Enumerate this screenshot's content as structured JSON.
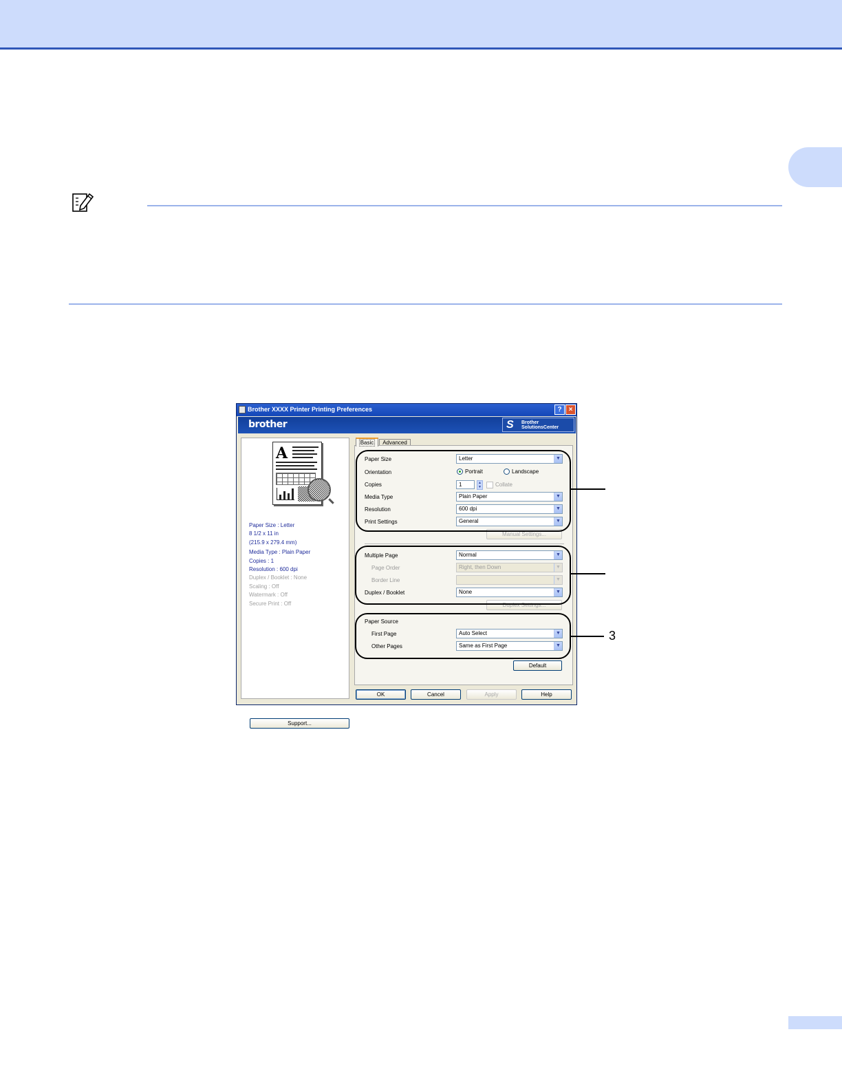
{
  "dialog": {
    "title": "Brother  XXXX  Printer Printing Preferences",
    "help_button": "?",
    "close_button": "×",
    "brand": "brother",
    "solutions_glyph": "S",
    "solutions_line1": "Brother",
    "solutions_line2": "SolutionsCenter",
    "tabs": [
      "Basic",
      "Advanced"
    ],
    "summary": [
      "Paper Size : Letter",
      "8 1/2 x 11 in",
      "(215.9 x 279.4 mm)",
      "Media Type : Plain Paper",
      "Copies : 1",
      "Resolution : 600 dpi",
      "Duplex / Booklet : None",
      "Scaling : Off",
      "Watermark : Off",
      "Secure Print : Off"
    ],
    "support_button": "Support...",
    "paper_size": {
      "label": "Paper Size",
      "value": "Letter"
    },
    "orientation": {
      "label": "Orientation",
      "portrait": "Portrait",
      "landscape": "Landscape"
    },
    "copies": {
      "label": "Copies",
      "value": "1",
      "collate": "Collate"
    },
    "media_type": {
      "label": "Media Type",
      "value": "Plain Paper"
    },
    "resolution": {
      "label": "Resolution",
      "value": "600 dpi"
    },
    "print_settings": {
      "label": "Print Settings",
      "value": "General"
    },
    "manual_settings_button": "Manual Settings...",
    "multiple_page": {
      "label": "Multiple Page",
      "value": "Normal"
    },
    "page_order": {
      "label": "Page Order",
      "value": "Right, then Down"
    },
    "border_line": {
      "label": "Border Line",
      "value": ""
    },
    "duplex_booklet": {
      "label": "Duplex / Booklet",
      "value": "None"
    },
    "duplex_settings_button": "Duplex Settings...",
    "paper_source": {
      "heading": "Paper Source",
      "first_page_label": "First Page",
      "first_page_value": "Auto Select",
      "other_pages_label": "Other Pages",
      "other_pages_value": "Same as First Page"
    },
    "default_button": "Default",
    "ok_button": "OK",
    "cancel_button": "Cancel",
    "apply_button": "Apply",
    "help_btn": "Help"
  },
  "callouts": {
    "third": "3"
  },
  "icons": {
    "dropdown": "chevron-down-icon",
    "note": "note-pencil-icon"
  },
  "colors": {
    "band": "#cddcfc",
    "rule": "#9bb3ea",
    "title_bar": "#1447b8"
  }
}
